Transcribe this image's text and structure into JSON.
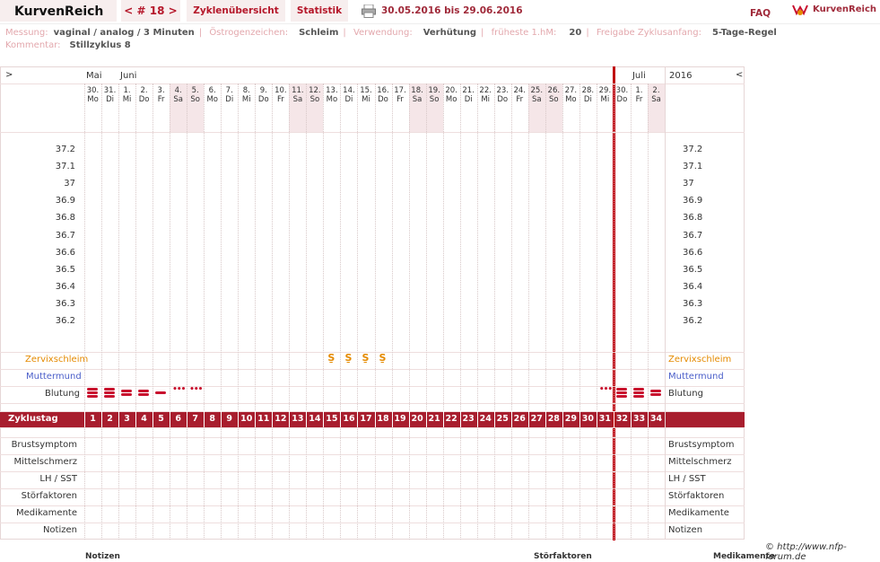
{
  "app": {
    "name": "KurvenReich",
    "brand": "KurvenReich",
    "faq": "FAQ"
  },
  "nav": {
    "cycle": "< # 18 >",
    "overview": "Zyklenübersicht",
    "stats": "Statistik",
    "range": "30.05.2016 bis 29.06.2016"
  },
  "meta": {
    "messung_label": "Messung:",
    "messung": "vaginal / analog / 3 Minuten",
    "oest_label": "Östrogenzeichen:",
    "oest": "Schleim",
    "verw_label": "Verwendung:",
    "verw": "Verhütung",
    "fruh_label": "früheste 1.hM:",
    "fruh": "20",
    "frei_label": "Freigabe Zyklusanfang:",
    "frei": "5-Tage-Regel",
    "komm_label": "Kommentar:",
    "komm": "Stillzyklus 8"
  },
  "chart": {
    "nav_left": ">",
    "nav_right": "<",
    "year": "2016",
    "months": [
      {
        "label": "Mai",
        "col": 0
      },
      {
        "label": "Juni",
        "col": 2
      },
      {
        "label": "Juli",
        "col": 32
      }
    ],
    "days": [
      {
        "n": "30.",
        "w": "Mo"
      },
      {
        "n": "31.",
        "w": "Di"
      },
      {
        "n": "1.",
        "w": "Mi"
      },
      {
        "n": "2.",
        "w": "Do"
      },
      {
        "n": "3.",
        "w": "Fr"
      },
      {
        "n": "4.",
        "w": "Sa"
      },
      {
        "n": "5.",
        "w": "So"
      },
      {
        "n": "6.",
        "w": "Mo"
      },
      {
        "n": "7.",
        "w": "Di"
      },
      {
        "n": "8.",
        "w": "Mi"
      },
      {
        "n": "9.",
        "w": "Do"
      },
      {
        "n": "10.",
        "w": "Fr"
      },
      {
        "n": "11.",
        "w": "Sa"
      },
      {
        "n": "12.",
        "w": "So"
      },
      {
        "n": "13.",
        "w": "Mo"
      },
      {
        "n": "14.",
        "w": "Di"
      },
      {
        "n": "15.",
        "w": "Mi"
      },
      {
        "n": "16.",
        "w": "Do"
      },
      {
        "n": "17.",
        "w": "Fr"
      },
      {
        "n": "18.",
        "w": "Sa"
      },
      {
        "n": "19.",
        "w": "So"
      },
      {
        "n": "20.",
        "w": "Mo"
      },
      {
        "n": "21.",
        "w": "Di"
      },
      {
        "n": "22.",
        "w": "Mi"
      },
      {
        "n": "23.",
        "w": "Do"
      },
      {
        "n": "24.",
        "w": "Fr"
      },
      {
        "n": "25.",
        "w": "Sa"
      },
      {
        "n": "26.",
        "w": "So"
      },
      {
        "n": "27.",
        "w": "Mo"
      },
      {
        "n": "28.",
        "w": "Di"
      },
      {
        "n": "29.",
        "w": "Mi"
      },
      {
        "n": "30.",
        "w": "Do"
      },
      {
        "n": "1.",
        "w": "Fr"
      },
      {
        "n": "2.",
        "w": "Sa"
      }
    ],
    "temps": [
      "37.2",
      "37.1",
      "37",
      "36.9",
      "36.8",
      "36.7",
      "36.6",
      "36.5",
      "36.4",
      "36.3",
      "36.2"
    ],
    "rows": {
      "zervix": "Zervixschleim",
      "mutter": "Muttermund",
      "blutung": "Blutung",
      "zyklustag": "Zyklustag"
    },
    "zervix_color": "#e58a00",
    "mutter_color": "#4a5ec9",
    "bottom_rows": [
      "Brustsymptom",
      "Mittelschmerz",
      "LH / SST",
      "Störfaktoren",
      "Medikamente",
      "Notizen"
    ],
    "mucus_symbol": "S̱",
    "mucus_days": [
      14,
      15,
      16,
      17
    ],
    "bleeding": [
      {
        "col": 0,
        "type": "heavy"
      },
      {
        "col": 1,
        "type": "heavy"
      },
      {
        "col": 2,
        "type": "medium"
      },
      {
        "col": 3,
        "type": "medium"
      },
      {
        "col": 4,
        "type": "light"
      },
      {
        "col": 5,
        "type": "spot"
      },
      {
        "col": 6,
        "type": "spot"
      },
      {
        "col": 30,
        "type": "spot"
      },
      {
        "col": 31,
        "type": "heavy"
      },
      {
        "col": 32,
        "type": "heavy"
      },
      {
        "col": 33,
        "type": "medium"
      }
    ],
    "cycle_days": [
      "1",
      "2",
      "3",
      "4",
      "5",
      "6",
      "7",
      "8",
      "9",
      "10",
      "11",
      "12",
      "13",
      "14",
      "15",
      "16",
      "17",
      "18",
      "19",
      "20",
      "21",
      "22",
      "23",
      "24",
      "25",
      "26",
      "27",
      "28",
      "29",
      "30",
      "31",
      "32",
      "33",
      "34"
    ],
    "accent": "#a81e2e"
  },
  "footer": {
    "credit": "© http://www.nfp-forum.de",
    "cut1": "Notizen",
    "cut2": "Störfaktoren",
    "cut3": "Medikamente"
  }
}
